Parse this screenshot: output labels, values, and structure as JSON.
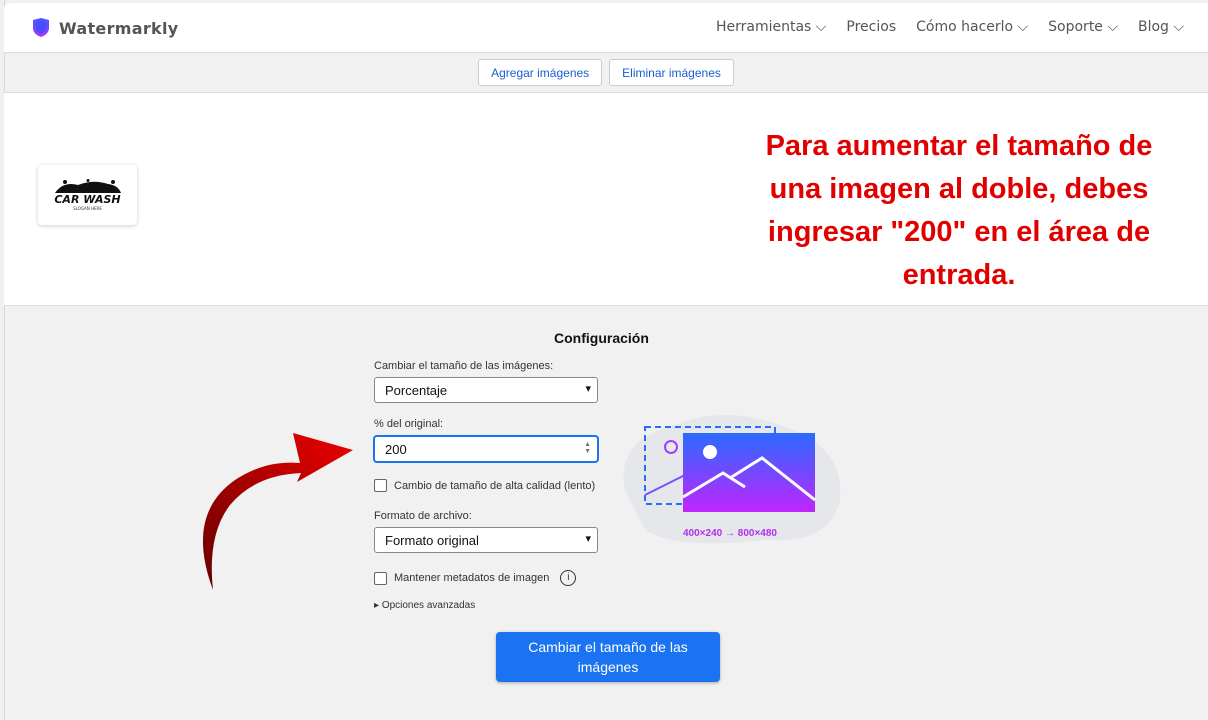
{
  "header": {
    "brand": "Watermarkly",
    "nav": [
      "Herramientas",
      "Precios",
      "Cómo hacerlo",
      "Soporte",
      "Blog"
    ]
  },
  "toolbar": {
    "add": "Agregar imágenes",
    "remove": "Eliminar imágenes"
  },
  "preview": {
    "thumb_text": "CAR WASH",
    "thumb_slogan": "SLOGAN HERE",
    "note": "Para aumentar el tamaño de una imagen al doble, debes ingresar \"200\" en el área de entrada."
  },
  "config": {
    "title": "Configuración",
    "resize_label": "Cambiar el tamaño de las imágenes:",
    "resize_value": "Porcentaje",
    "percent_label": "% del original:",
    "percent_value": "200",
    "hq_label": "Cambio de tamaño de alta calidad (lento)",
    "format_label": "Formato de archivo:",
    "format_value": "Formato original",
    "meta_label": "Mantener metadatos de imagen",
    "advanced": "Opciones avanzadas",
    "illustration_caption": "400×240 → 800×480",
    "submit": "Cambiar el tamaño de las imágenes"
  },
  "colors": {
    "accent": "#1a73f0",
    "note": "#e10000"
  }
}
